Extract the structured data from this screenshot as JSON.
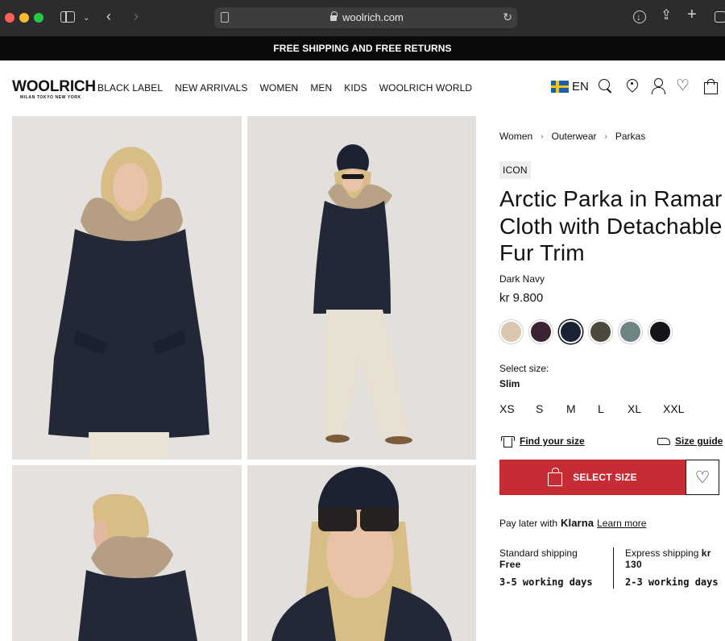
{
  "browser": {
    "url": "woolrich.com"
  },
  "promo": {
    "text": "FREE SHIPPING AND FREE RETURNS"
  },
  "header": {
    "logo": {
      "word": "WOOLRICH",
      "subtitle": "MILAN TOKYO NEW YORK"
    },
    "nav": [
      "BLACK LABEL",
      "NEW ARRIVALS",
      "WOMEN",
      "MEN",
      "KIDS",
      "WOOLRICH WORLD"
    ],
    "language": "EN",
    "icons": [
      "search-icon",
      "location-icon",
      "account-icon",
      "heart-icon",
      "bag-icon"
    ]
  },
  "product": {
    "breadcrumb": [
      "Women",
      "Outerwear",
      "Parkas"
    ],
    "badge": "ICON",
    "title": "Arctic Parka in Ramar Cloth with Detachable Fur Trim",
    "color_name": "Dark Navy",
    "price": "kr 9.800",
    "swatches": [
      {
        "color": "#d9c7b0",
        "selected": false
      },
      {
        "color": "#3a2433",
        "selected": false
      },
      {
        "color": "#1a2333",
        "selected": true
      },
      {
        "color": "#4c4a3c",
        "selected": false
      },
      {
        "color": "#6f8584",
        "selected": false
      },
      {
        "color": "#141418",
        "selected": false
      }
    ],
    "size_label": "Select size:",
    "fit": "Slim",
    "sizes": [
      "XS",
      "S",
      "M",
      "L",
      "XL",
      "XXL"
    ],
    "find_size": "Find your size",
    "size_guide": "Size guide",
    "cta_label": "SELECT SIZE",
    "accent_color": "#c52c33",
    "klarna": {
      "prefix": "Pay later with",
      "brand": "Klarna",
      "link": "Learn more"
    },
    "shipping": {
      "standard": {
        "title": "Standard shipping",
        "price": "Free",
        "days": "3-5 working days"
      },
      "express": {
        "title": "Express shipping",
        "price": "kr 130",
        "days": "2-3 working days"
      }
    }
  }
}
